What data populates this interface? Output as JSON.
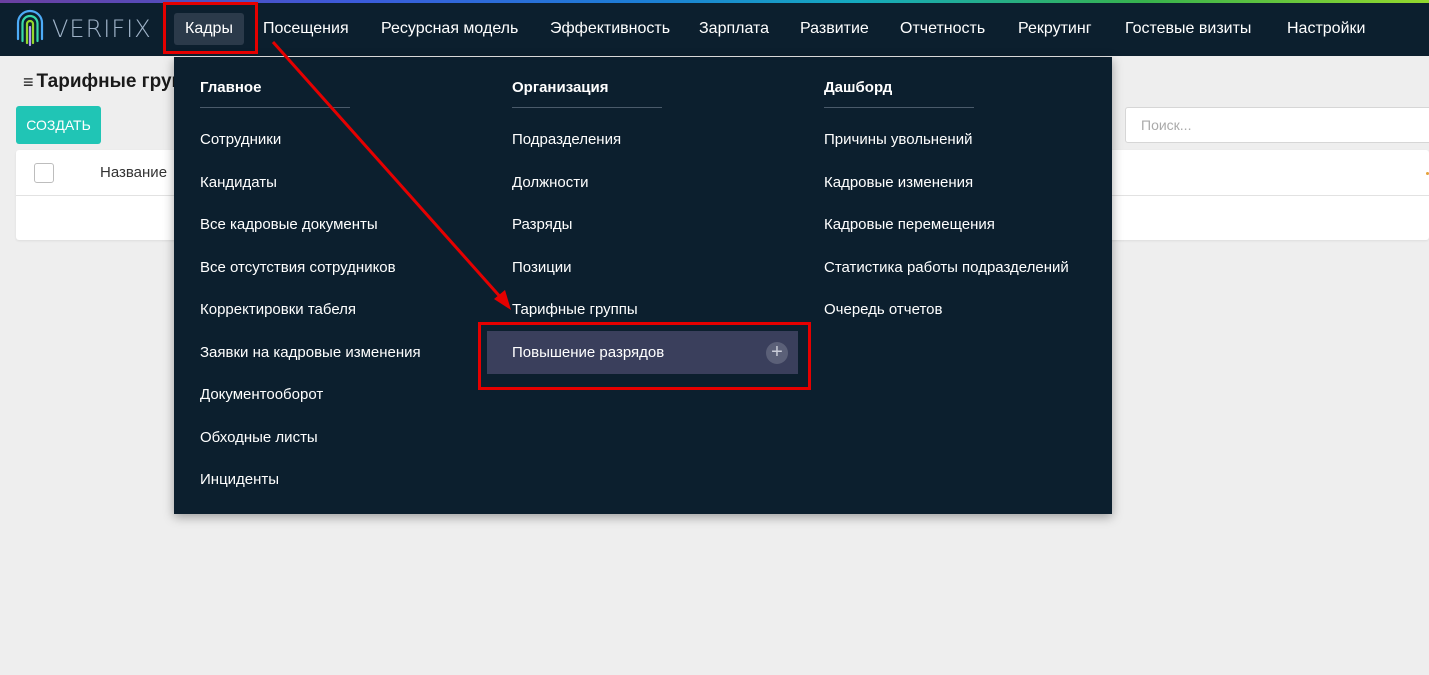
{
  "brand": {
    "name": "VERIFIX"
  },
  "nav": {
    "items": [
      {
        "label": "Кадры",
        "active": true
      },
      {
        "label": "Посещения"
      },
      {
        "label": "Ресурсная модель"
      },
      {
        "label": "Эффективность"
      },
      {
        "label": "Зарплата"
      },
      {
        "label": "Развитие"
      },
      {
        "label": "Отчетность"
      },
      {
        "label": "Рекрутинг"
      },
      {
        "label": "Гостевые визиты"
      },
      {
        "label": "Настройки"
      }
    ]
  },
  "page": {
    "title": "Тарифные груп",
    "create_label": "СОЗДАТЬ",
    "search_placeholder": "Поиск...",
    "table": {
      "col_name": "Название"
    }
  },
  "menu": {
    "columns": [
      {
        "heading": "Главное",
        "items": [
          "Сотрудники",
          "Кандидаты",
          "Все кадровые документы",
          "Все отсутствия сотрудников",
          "Корректировки табеля",
          "Заявки на кадровые изменения",
          "Документооборот",
          "Обходные листы",
          "Инциденты"
        ]
      },
      {
        "heading": "Организация",
        "items": [
          "Подразделения",
          "Должности",
          "Разряды",
          "Позиции",
          "Тарифные группы",
          "Повышение разрядов"
        ]
      },
      {
        "heading": "Дашборд",
        "items": [
          "Причины увольнений",
          "Кадровые изменения",
          "Кадровые перемещения",
          "Статистика работы подразделений",
          "Очередь отчетов"
        ]
      }
    ],
    "plus_symbol": "+"
  },
  "colors": {
    "navbar": "#0c1f2e",
    "accent": "#20c5b5",
    "highlight": "#3a3f5c",
    "annotation": "#e50000"
  }
}
